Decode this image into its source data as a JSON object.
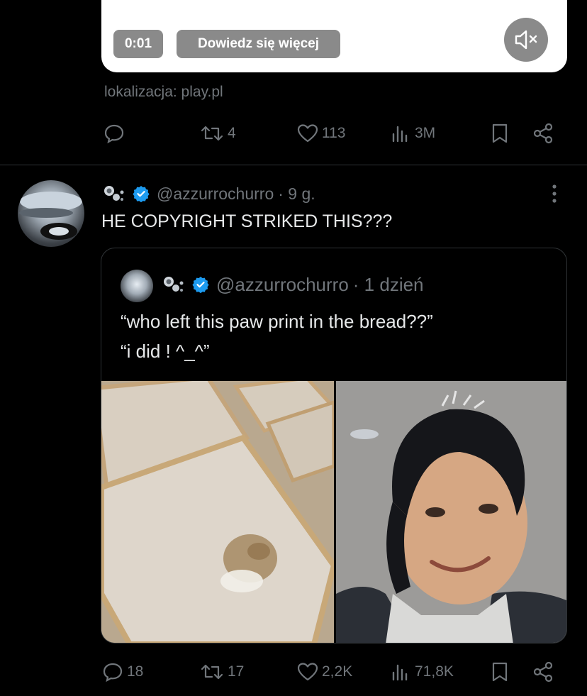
{
  "video": {
    "time": "0:01",
    "learn_more": "Dowiedz się więcej"
  },
  "location": "lokalizacja: play.pl",
  "ad_actions": {
    "retweets": "4",
    "likes": "113",
    "views": "3M"
  },
  "tweet": {
    "handle": "@azzurrochurro",
    "time": "· 9 g.",
    "text": "HE COPYRIGHT STRIKED THIS???"
  },
  "quoted": {
    "handle": "@azzurrochurro",
    "time": "· 1 dzień",
    "line1": "“who left this paw print in the bread??”",
    "line2": "“i did ! ^_^”"
  },
  "tweet_actions": {
    "replies": "18",
    "retweets": "17",
    "likes": "2,2K",
    "views": "71,8K"
  },
  "colors": {
    "background": "#000000",
    "text": "#e7e9ea",
    "muted": "#71767b",
    "verified": "#1d9bf0",
    "chip": "#8a8a8a"
  },
  "icons": [
    "speaker-muted-icon",
    "reply-icon",
    "retweet-icon",
    "heart-icon",
    "views-icon",
    "bookmark-icon",
    "share-icon",
    "verified-badge-icon",
    "more-dots-icon",
    "avatar-decoration-icon"
  ]
}
